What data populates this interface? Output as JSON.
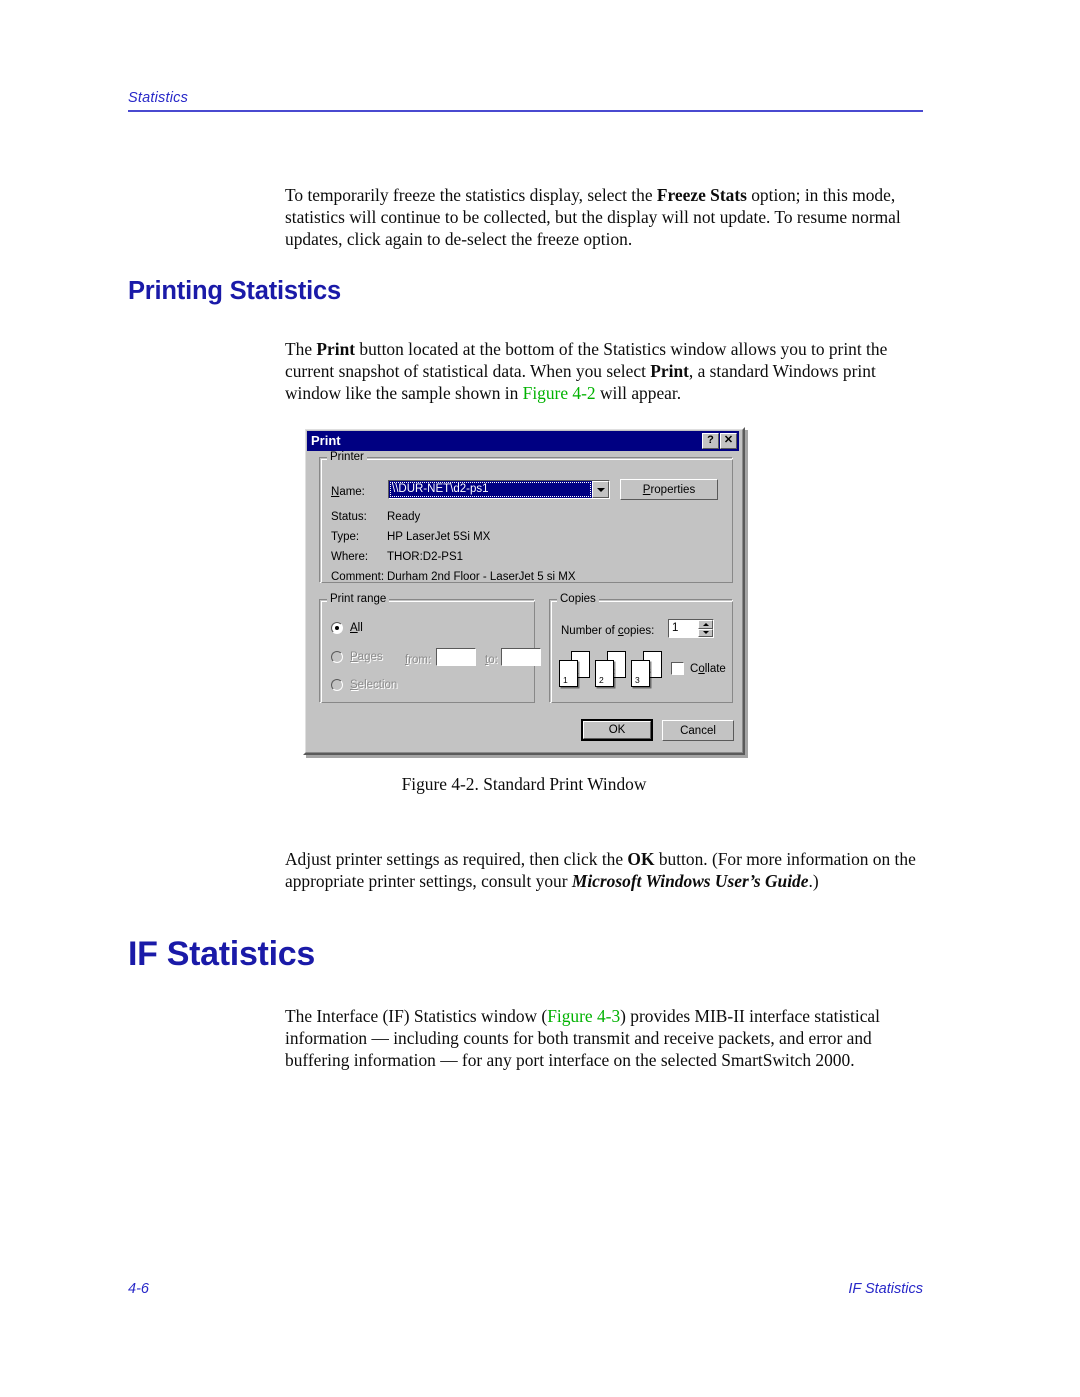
{
  "page": {
    "running_head": "Statistics",
    "footer_left": "4-6",
    "footer_right": "IF Statistics",
    "accent_blue": "#2828c8",
    "heading_blue": "#1a1aa8",
    "xref_green": "#00b200"
  },
  "content": {
    "intro_paragraph": {
      "part1": "To temporarily freeze the statistics display, select the ",
      "bold1": "Freeze Stats",
      "part2": " option; in this mode, statistics will continue to be collected, but the display will not update. To resume normal updates, click again to de-select the freeze option."
    },
    "heading_printing_statistics": "Printing Statistics",
    "printing_paragraph": {
      "part1": "The ",
      "bold1": "Print",
      "part2": " button located at the bottom of the Statistics window allows you to print the current snapshot of statistical data. When you select ",
      "bold2": "Print",
      "part3": ", a standard Windows print window like the sample shown in ",
      "xref": "Figure 4-2",
      "part4": " will appear."
    },
    "figure_caption": "Figure 4-2.  Standard Print Window",
    "adjust_paragraph": {
      "part1": "Adjust printer settings as required, then click the ",
      "bold1": "OK",
      "part2": " button. (For more information on the appropriate printer settings, consult your ",
      "bolditalic1": "Microsoft Windows User’s Guide",
      "part3": ".)"
    },
    "heading_if_statistics": "IF Statistics",
    "if_paragraph": {
      "part1": "The Interface (IF) Statistics window (",
      "xref": "Figure 4-3",
      "part2": ") provides MIB-II interface statistical information — including counts for both transmit and receive packets, and error and buffering information — for any port interface on the selected SmartSwitch 2000."
    }
  },
  "print_dialog": {
    "title": "Print",
    "titlebar_color": "#000082",
    "help_button": "?",
    "close_button": "✕",
    "printer_group": {
      "legend": "Printer",
      "name_label": "Name:",
      "name_value": "\\\\DUR-NET\\d2-ps1",
      "properties_button": "Properties",
      "status_label": "Status:",
      "status_value": "Ready",
      "type_label": "Type:",
      "type_value": "HP LaserJet 5Si MX",
      "where_label": "Where:",
      "where_value": "THOR:D2-PS1",
      "comment_label": "Comment:",
      "comment_value": "Durham 2nd Floor - LaserJet 5 si MX"
    },
    "print_range_group": {
      "legend": "Print range",
      "all_label": "All",
      "all_selected": true,
      "pages_label": "Pages",
      "from_label": "from:",
      "from_value": "",
      "to_label": "to:",
      "to_value": "",
      "selection_label": "Selection"
    },
    "copies_group": {
      "legend": "Copies",
      "number_label": "Number of copies:",
      "number_value": "1",
      "collate_label": "Collate",
      "collate_checked": false,
      "collate_pages": [
        {
          "front": "1",
          "back": "1"
        },
        {
          "front": "2",
          "back": "2"
        },
        {
          "front": "3",
          "back": "3"
        }
      ]
    },
    "ok_button": "OK",
    "cancel_button": "Cancel"
  }
}
